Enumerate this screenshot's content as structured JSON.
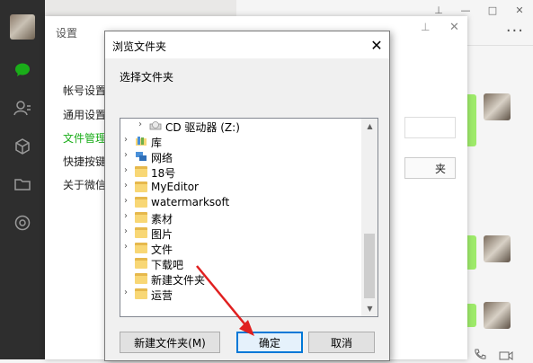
{
  "settings": {
    "title": "设置",
    "menu": [
      "帐号设置",
      "通用设置",
      "文件管理",
      "快捷按键",
      "关于微信"
    ],
    "active_index": 2,
    "button_partial": "夹"
  },
  "dialog": {
    "title": "浏览文件夹",
    "prompt": "选择文件夹",
    "tree": [
      {
        "label": "CD 驱动器 (Z:)",
        "icon": "cd-drive-icon",
        "expander": "chevron-right"
      },
      {
        "label": "库",
        "icon": "library-icon",
        "expander": "chevron-right"
      },
      {
        "label": "网络",
        "icon": "network-icon",
        "expander": "chevron-right"
      },
      {
        "label": "18号",
        "icon": "folder-icon",
        "expander": "chevron-right"
      },
      {
        "label": "MyEditor",
        "icon": "folder-icon",
        "expander": "chevron-right"
      },
      {
        "label": "watermarksoft",
        "icon": "folder-icon",
        "expander": "chevron-right"
      },
      {
        "label": "素材",
        "icon": "folder-icon",
        "expander": "chevron-right"
      },
      {
        "label": "图片",
        "icon": "folder-icon",
        "expander": "chevron-right"
      },
      {
        "label": "文件",
        "icon": "folder-icon",
        "expander": "chevron-right"
      },
      {
        "label": "下载吧",
        "icon": "folder-icon",
        "expander": ""
      },
      {
        "label": "新建文件夹",
        "icon": "folder-icon",
        "expander": ""
      },
      {
        "label": "运营",
        "icon": "folder-icon",
        "expander": "chevron-right"
      }
    ],
    "buttons": {
      "new_folder": "新建文件夹(M)",
      "ok": "确定",
      "cancel": "取消"
    }
  },
  "window_controls": [
    "pin-icon",
    "minimize-icon",
    "maximize-icon",
    "close-icon"
  ],
  "colors": {
    "wechat_green": "#1aad19",
    "bubble_green": "#9eea6a",
    "focus_blue": "#0078d7",
    "arrow_red": "#e02020"
  }
}
